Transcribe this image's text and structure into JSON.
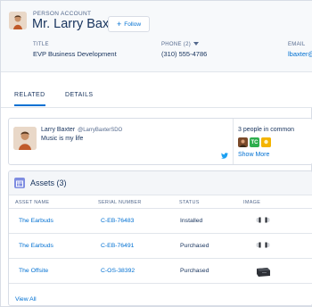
{
  "header": {
    "eyebrow": "PERSON ACCOUNT",
    "name": "Mr. Larry Baxter",
    "follow_label": "Follow",
    "fields": [
      {
        "label": "TITLE",
        "value": "EVP Business Development"
      },
      {
        "label": "PHONE (2)",
        "value": "(310) 555-4786"
      },
      {
        "label": "EMAIL",
        "value": "lbaxter@"
      }
    ]
  },
  "tabs": [
    {
      "label": "RELATED",
      "active": true
    },
    {
      "label": "DETAILS",
      "active": false
    }
  ],
  "social": {
    "display_name": "Larry Baxter",
    "handle": "@LarryBaxterSDO",
    "status": "Music is my life",
    "common_label": "3 people in common",
    "show_more": "Show More",
    "common_people": [
      {
        "initials": "",
        "color": "#7a4a2a"
      },
      {
        "initials": "TC",
        "color": "#2eae4e"
      },
      {
        "initials": "",
        "color": "#f4b400"
      }
    ]
  },
  "assets": {
    "title": "Assets (3)",
    "columns": [
      "ASSET NAME",
      "SERIAL NUMBER",
      "STATUS",
      "IMAGE"
    ],
    "rows": [
      {
        "name": "The Earbuds",
        "serial": "C-EB-76483",
        "status": "Installed",
        "image_icon": "earbuds-icon"
      },
      {
        "name": "The Earbuds",
        "serial": "C-EB-76491",
        "status": "Purchased",
        "image_icon": "earbuds-icon"
      },
      {
        "name": "The Offsite",
        "serial": "C-OS-38392",
        "status": "Purchased",
        "image_icon": "speaker-icon"
      }
    ],
    "view_all": "View All"
  },
  "colors": {
    "link": "#0070d2",
    "text": "#16325c",
    "muted": "#54698d",
    "asset_icon": "#7f8de1"
  }
}
